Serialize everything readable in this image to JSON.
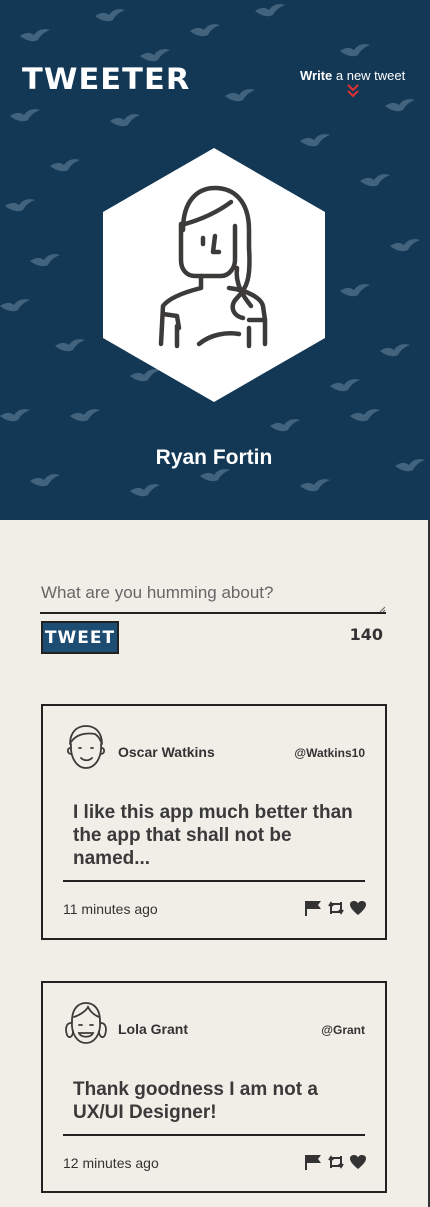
{
  "app": {
    "logo": "TWEETER",
    "write_link_bold": "Write",
    "write_link_rest": " a new tweet"
  },
  "profile": {
    "name": "Ryan Fortin"
  },
  "compose": {
    "placeholder": "What are you humming about?",
    "button_label": "TWEET",
    "char_count": "140"
  },
  "tweets": [
    {
      "name": "Oscar Watkins",
      "handle": "@Watkins10",
      "text": "I like this app much better than the app that shall not be named...",
      "time": "11 minutes ago",
      "avatar_icon": "boy-avatar-icon"
    },
    {
      "name": "Lola Grant",
      "handle": "@Grant",
      "text": "Thank goodness I am not a UX/UI Designer!",
      "time": "12 minutes ago",
      "avatar_icon": "girl-avatar-icon"
    }
  ],
  "colors": {
    "header_bg": "#133856",
    "page_bg": "#f1eee8",
    "button_bg": "#1d4d72",
    "accent_red": "#e03030"
  }
}
